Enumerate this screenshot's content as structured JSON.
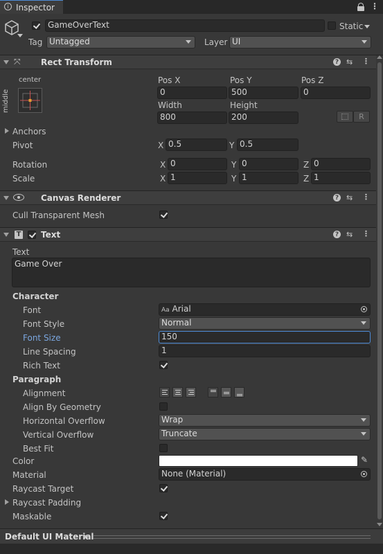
{
  "tab": {
    "title": "Inspector"
  },
  "object": {
    "name": "GameOverText",
    "static_label": "Static",
    "tag_label": "Tag",
    "tag_value": "Untagged",
    "layer_label": "Layer",
    "layer_value": "UI"
  },
  "rect_transform": {
    "title": "Rect Transform",
    "anchor_h": "center",
    "anchor_v": "middle",
    "posx_label": "Pos X",
    "posy_label": "Pos Y",
    "posz_label": "Pos Z",
    "posx": "0",
    "posy": "500",
    "posz": "0",
    "width_label": "Width",
    "height_label": "Height",
    "width": "800",
    "height": "200",
    "r_label": "R",
    "anchors_label": "Anchors",
    "pivot_label": "Pivot",
    "pivot_x": "0.5",
    "pivot_y": "0.5",
    "rotation_label": "Rotation",
    "rot_x": "0",
    "rot_y": "0",
    "rot_z": "0",
    "scale_label": "Scale",
    "scale_x": "1",
    "scale_y": "1",
    "scale_z": "1",
    "x": "X",
    "y": "Y",
    "z": "Z"
  },
  "canvas_renderer": {
    "title": "Canvas Renderer",
    "cull_label": "Cull Transparent Mesh"
  },
  "text": {
    "title": "Text",
    "icon_letter": "T",
    "text_label": "Text",
    "text_value": "Game Over",
    "character_label": "Character",
    "font_label": "Font",
    "font_prefix": "Aa",
    "font_value": "Arial",
    "font_style_label": "Font Style",
    "font_style_value": "Normal",
    "font_size_label": "Font Size",
    "font_size_value": "150",
    "line_spacing_label": "Line Spacing",
    "line_spacing_value": "1",
    "rich_text_label": "Rich Text",
    "paragraph_label": "Paragraph",
    "alignment_label": "Alignment",
    "align_geometry_label": "Align By Geometry",
    "h_overflow_label": "Horizontal Overflow",
    "h_overflow_value": "Wrap",
    "v_overflow_label": "Vertical Overflow",
    "v_overflow_value": "Truncate",
    "best_fit_label": "Best Fit",
    "color_label": "Color",
    "color_value": "#ffffff",
    "material_label": "Material",
    "material_value": "None (Material)",
    "raycast_target_label": "Raycast Target",
    "raycast_padding_label": "Raycast Padding",
    "maskable_label": "Maskable"
  },
  "footer": {
    "material_label": "Default UI Material"
  },
  "colors": {
    "accent": "#4d8bd6",
    "panel": "#383838",
    "field": "#2a2a2a"
  }
}
